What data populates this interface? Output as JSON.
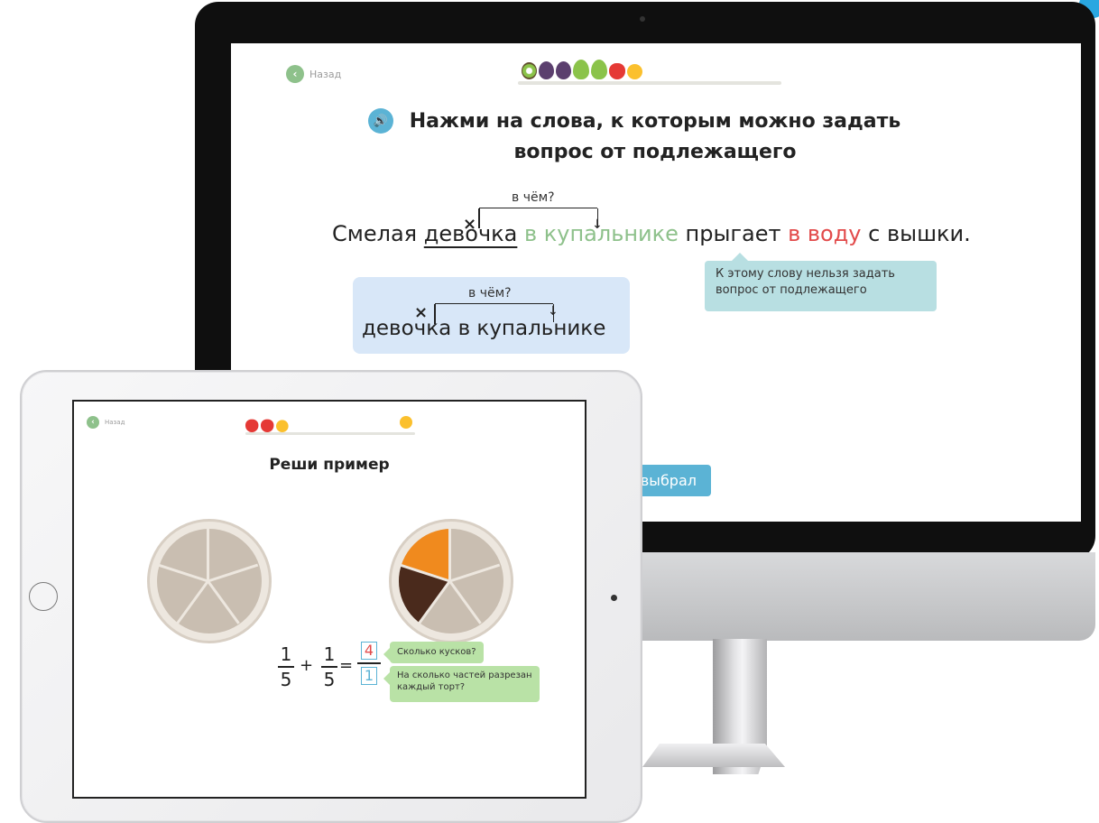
{
  "desktop_lesson": {
    "back_label": "Назад",
    "progress_fruits": [
      "kiwi",
      "plum",
      "plum",
      "pear",
      "pear",
      "apple",
      "lemon"
    ],
    "title_line1": "Нажми на слова, к которым можно задать",
    "title_line2": "вопрос от подлежащего",
    "speaker_icon": "🔊",
    "question_label": "в чём?",
    "sentence": {
      "w1": "Смелая",
      "w2": "девочка",
      "w3": "в купальнике",
      "w4": "прыгает",
      "w5": "в воду",
      "w6": "с вышки."
    },
    "tooltip_text": "К этому слову нельзя задать вопрос от подлежащего",
    "phrase_question": "в чём?",
    "phrase_text": "девочка в купальнике",
    "chose_button_label": "выбрал",
    "colors": {
      "correct": "#8ec18b",
      "wrong": "#e24b4b",
      "accent": "#5bb3d5"
    }
  },
  "tablet_lesson": {
    "back_label": "Назад",
    "progress_fruits": [
      "apple",
      "apple",
      "lemon"
    ],
    "goal_fruit": "lemon",
    "title": "Реши пример",
    "equation": {
      "a_num": "1",
      "a_den": "5",
      "plus": "+",
      "b_num": "1",
      "b_den": "5",
      "equals": "=",
      "answer_num": "4",
      "answer_den": "1"
    },
    "hint_pieces": "Сколько кусков?",
    "hint_parts": "На сколько частей разрезан каждый торт?"
  }
}
